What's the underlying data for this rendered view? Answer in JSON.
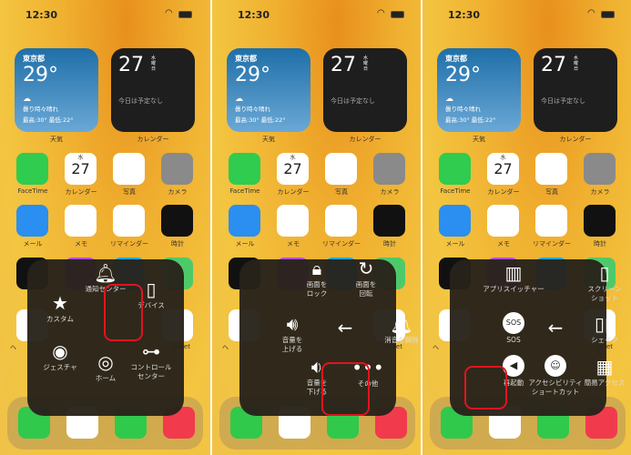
{
  "status": {
    "time": "12:30"
  },
  "home": {
    "weather": {
      "city": "東京都",
      "temp": "29°",
      "condition": "曇り時々晴れ",
      "range": "最高:30° 最低:22°",
      "label": "天気"
    },
    "calendar_widget": {
      "day": "27",
      "weekday": "水\n曜\n日",
      "events": "今日は予定なし",
      "label": "カレンダー"
    },
    "apps_row1": [
      {
        "label": "FaceTime",
        "color": "#2fcc4f"
      },
      {
        "label": "カレンダー",
        "color": "#ffffff"
      },
      {
        "label": "写真",
        "color": "#ffffff"
      },
      {
        "label": "カメラ",
        "color": "#8a8a8a"
      }
    ],
    "apps_row2": [
      {
        "label": "メール",
        "color": "#2a8ff0"
      },
      {
        "label": "メモ",
        "color": "#ffffff"
      },
      {
        "label": "リマインダー",
        "color": "#ffffff"
      },
      {
        "label": "時計",
        "color": "#111111"
      }
    ],
    "cal_icon": {
      "weekday": "水",
      "day": "27"
    },
    "partial_labels": {
      "left": "ヘ",
      "right": "ocket"
    },
    "dock": [
      {
        "name": "phone",
        "color": "#30c94c"
      },
      {
        "name": "safari",
        "color": "#ffffff"
      },
      {
        "name": "messages",
        "color": "#30c94c"
      },
      {
        "name": "music",
        "color": "#f23a4d"
      }
    ]
  },
  "panels": [
    {
      "menu": "top-level",
      "items": [
        {
          "label": "通知センター",
          "icon": "bell-icon"
        },
        {
          "label": "カスタム",
          "icon": "star-icon"
        },
        {
          "label": "デバイス",
          "icon": "iphone-icon",
          "highlighted": true
        },
        {
          "label": "ジェスチャ",
          "icon": "gesture-icon"
        },
        {
          "label": "ホーム",
          "icon": "home-button-icon"
        },
        {
          "label": "コントロール\nセンター",
          "icon": "toggle-icon"
        }
      ]
    },
    {
      "menu": "device",
      "items": [
        {
          "label": "画面を\nロック",
          "icon": "lock-icon"
        },
        {
          "label": "画面を\n回転",
          "icon": "rotate-icon"
        },
        {
          "label": "音量を\n上げる",
          "icon": "volume-up-icon"
        },
        {
          "label": "",
          "icon": "back-arrow-icon"
        },
        {
          "label": "消音を解除",
          "icon": "bell-icon"
        },
        {
          "label": "音量を\n下げる",
          "icon": "volume-down-icon"
        },
        {
          "label": "その他",
          "icon": "more-icon",
          "highlighted": true
        }
      ]
    },
    {
      "menu": "more",
      "items": [
        {
          "label": "アプリスイッチャー",
          "icon": "app-switcher-icon"
        },
        {
          "label": "スクリーン\nショット",
          "icon": "screenshot-icon"
        },
        {
          "label": "SOS",
          "icon": "sos-icon"
        },
        {
          "label": "",
          "icon": "back-arrow-icon"
        },
        {
          "label": "シェイク",
          "icon": "shake-icon"
        },
        {
          "label": "再起動",
          "icon": "restart-icon",
          "highlighted": true
        },
        {
          "label": "アクセシビリティ\nショートカット",
          "icon": "accessibility-icon"
        },
        {
          "label": "簡易アクセス",
          "icon": "reachability-icon"
        }
      ]
    }
  ],
  "colors": {
    "highlight": "#e0141e",
    "menu_bg": "#28221a"
  }
}
